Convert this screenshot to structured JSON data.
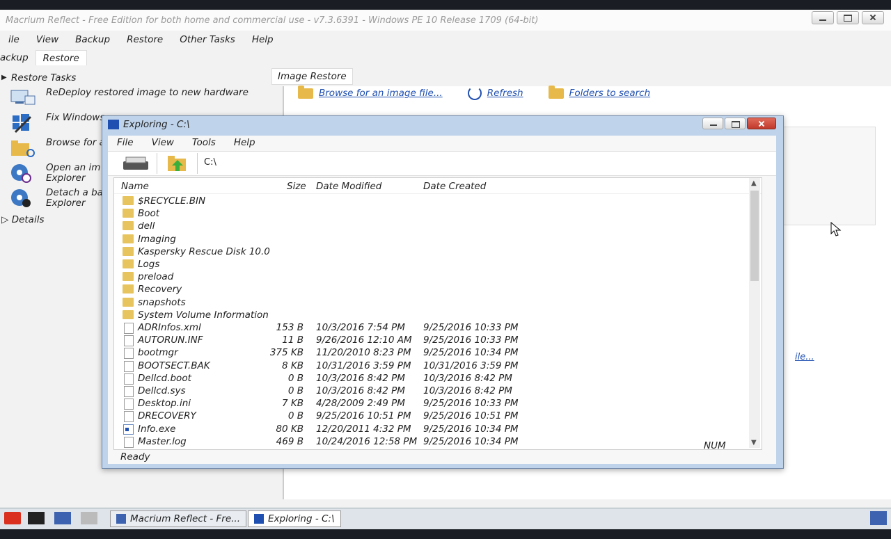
{
  "app": {
    "title": "Macrium Reflect - Free Edition for both home and commercial use - v7.3.6391 - Windows PE 10 Release 1709 (64-bit)",
    "menu": [
      "ile",
      "View",
      "Backup",
      "Restore",
      "Other Tasks",
      "Help"
    ],
    "tabs": [
      "ackup",
      "Restore"
    ]
  },
  "tasks": {
    "header": "Restore Tasks",
    "items": [
      {
        "label": "ReDeploy restored image to new hardware",
        "icon": "redeploy-icon"
      },
      {
        "label": "Fix Windows",
        "icon": "fix-windows-icon"
      },
      {
        "label": "Browse for a",
        "icon": "browse-folder-icon"
      },
      {
        "label": "Open an im",
        "sublabel": "Explorer",
        "icon": "open-image-icon"
      },
      {
        "label": "Detach a ba",
        "sublabel": "Explorer",
        "icon": "detach-image-icon"
      }
    ],
    "details": "Details"
  },
  "image_restore": {
    "tab": "Image Restore",
    "browse": "Browse for an image file...",
    "refresh": "Refresh",
    "folders": "Folders to search",
    "partial_link": "ile..."
  },
  "explorer": {
    "title": "Exploring - C:\\",
    "menu": [
      "File",
      "View",
      "Tools",
      "Help"
    ],
    "path": "C:\\",
    "columns": {
      "name": "Name",
      "size": "Size",
      "modified": "Date Modified",
      "created": "Date Created"
    },
    "rows": [
      {
        "name": "$RECYCLE.BIN",
        "type": "folder",
        "size": "",
        "modified": "",
        "created": ""
      },
      {
        "name": "Boot",
        "type": "folder",
        "size": "",
        "modified": "",
        "created": ""
      },
      {
        "name": "dell",
        "type": "folder",
        "size": "",
        "modified": "",
        "created": ""
      },
      {
        "name": "Imaging",
        "type": "folder",
        "size": "",
        "modified": "",
        "created": ""
      },
      {
        "name": "Kaspersky Rescue Disk 10.0",
        "type": "folder",
        "size": "",
        "modified": "",
        "created": ""
      },
      {
        "name": "Logs",
        "type": "folder",
        "size": "",
        "modified": "",
        "created": ""
      },
      {
        "name": "preload",
        "type": "folder",
        "size": "",
        "modified": "",
        "created": ""
      },
      {
        "name": "Recovery",
        "type": "folder",
        "size": "",
        "modified": "",
        "created": ""
      },
      {
        "name": "snapshots",
        "type": "folder",
        "size": "",
        "modified": "",
        "created": ""
      },
      {
        "name": "System Volume Information",
        "type": "folder",
        "size": "",
        "modified": "",
        "created": ""
      },
      {
        "name": "ADRInfos.xml",
        "type": "file",
        "size": "153 B",
        "modified": "10/3/2016 7:54 PM",
        "created": "9/25/2016 10:33 PM"
      },
      {
        "name": "AUTORUN.INF",
        "type": "file",
        "size": "11 B",
        "modified": "9/26/2016 12:10 AM",
        "created": "9/25/2016 10:33 PM"
      },
      {
        "name": "bootmgr",
        "type": "file",
        "size": "375 KB",
        "modified": "11/20/2010 8:23 PM",
        "created": "9/25/2016 10:34 PM"
      },
      {
        "name": "BOOTSECT.BAK",
        "type": "file",
        "size": "8 KB",
        "modified": "10/31/2016 3:59 PM",
        "created": "10/31/2016 3:59 PM"
      },
      {
        "name": "Dellcd.boot",
        "type": "file",
        "size": "0 B",
        "modified": "10/3/2016 8:42 PM",
        "created": "10/3/2016 8:42 PM"
      },
      {
        "name": "Dellcd.sys",
        "type": "file",
        "size": "0 B",
        "modified": "10/3/2016 8:42 PM",
        "created": "10/3/2016 8:42 PM"
      },
      {
        "name": "Desktop.ini",
        "type": "file",
        "size": "7 KB",
        "modified": "4/28/2009 2:49 PM",
        "created": "9/25/2016 10:33 PM"
      },
      {
        "name": "DRECOVERY",
        "type": "file",
        "size": "0 B",
        "modified": "9/25/2016 10:51 PM",
        "created": "9/25/2016 10:51 PM"
      },
      {
        "name": "Info.exe",
        "type": "exe",
        "size": "80 KB",
        "modified": "12/20/2011 4:32 PM",
        "created": "9/25/2016 10:34 PM"
      },
      {
        "name": "Master.log",
        "type": "file",
        "size": "469 B",
        "modified": "10/24/2016 12:58 PM",
        "created": "9/25/2016 10:34 PM"
      }
    ],
    "status": "Ready",
    "num": "NUM"
  },
  "taskbar": {
    "items": [
      "Macrium Reflect - Fre...",
      "Exploring - C:\\"
    ]
  }
}
